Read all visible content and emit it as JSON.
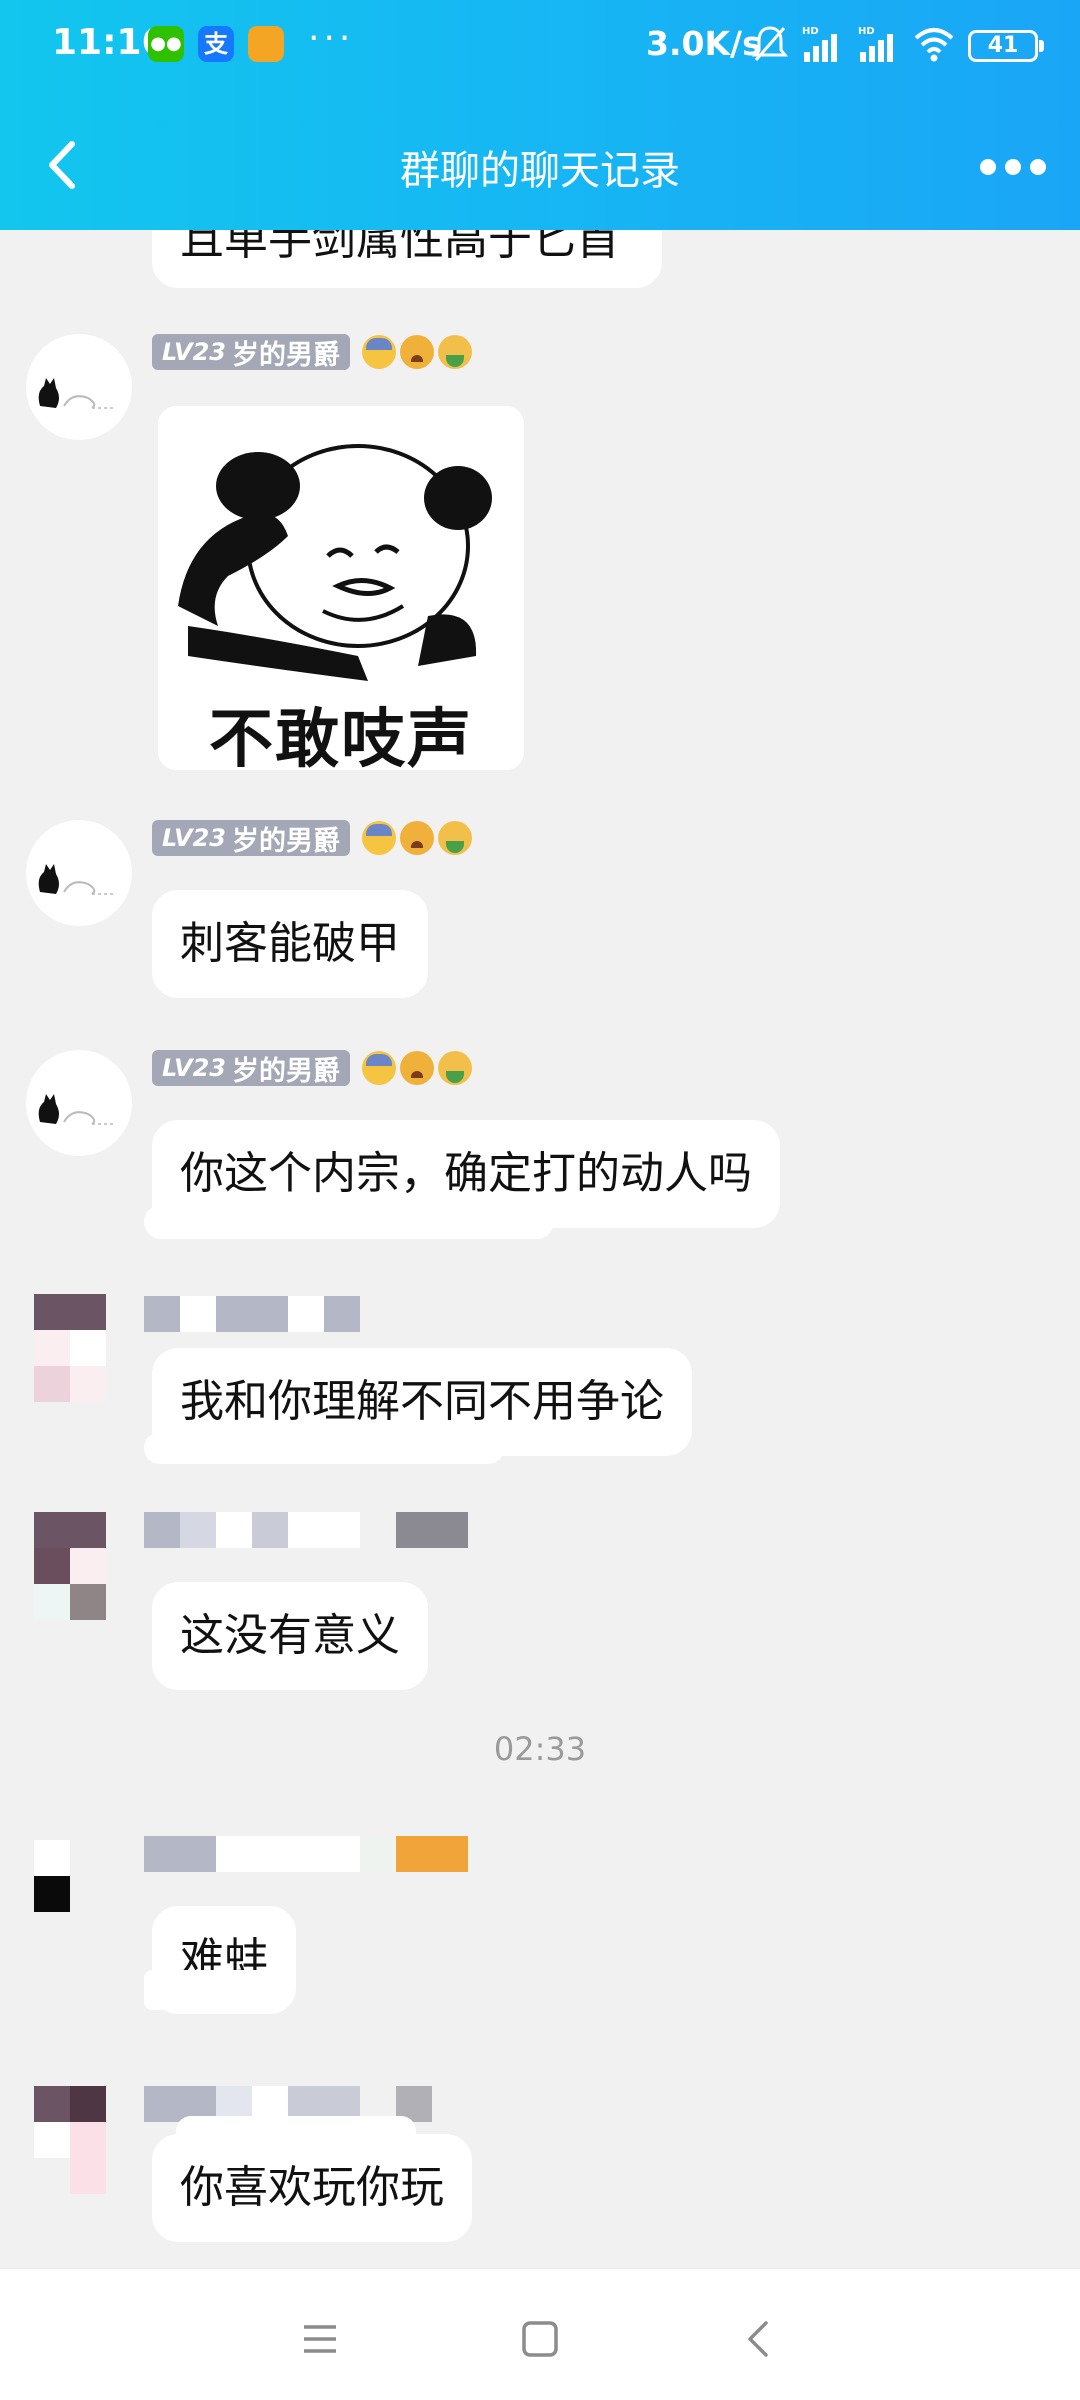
{
  "status_bar": {
    "time": "11:16",
    "network_speed": "3.0K/s",
    "battery_level": "41",
    "apps": [
      "wechat-icon",
      "alipay-icon",
      "notes-icon"
    ],
    "more": "···"
  },
  "header": {
    "title": "群聊的聊天记录",
    "back_icon": "chevron-left-icon",
    "menu_icon": "more-dots-icon"
  },
  "messages": [
    {
      "id": "m0",
      "text": "且单手剑属性高于匕首",
      "partial": true
    },
    {
      "id": "m1",
      "sender_badge_level": "LV23",
      "sender_name": "岁的男爵",
      "type": "sticker",
      "sticker_text": "不敢吱声"
    },
    {
      "id": "m2",
      "sender_badge_level": "LV23",
      "sender_name": "岁的男爵",
      "text": "刺客能破甲"
    },
    {
      "id": "m3",
      "sender_badge_level": "LV23",
      "sender_name": "岁的男爵",
      "text": "你这个内宗，确定打的动人吗"
    },
    {
      "id": "m4",
      "sender_pixelated": true,
      "text": "我和你理解不同不用争论"
    },
    {
      "id": "m5",
      "sender_pixelated": true,
      "text": "这没有意义"
    },
    {
      "id": "m6",
      "sender_pixelated": true,
      "text": "难蚌"
    },
    {
      "id": "m7",
      "sender_pixelated": true,
      "text": "你喜欢玩你玩"
    }
  ],
  "time_divider": "02:33",
  "emoji_tags": [
    "anxious-face-icon",
    "crying-face-icon",
    "vomiting-face-icon"
  ],
  "colors": {
    "header_start": "#12c6ee",
    "header_end": "#1aa6f6",
    "badge": "#a3a7b6",
    "chat_bg": "#f1f1f1",
    "bubble": "#ffffff"
  },
  "system_nav": [
    "menu-icon",
    "home-icon",
    "back-icon"
  ]
}
